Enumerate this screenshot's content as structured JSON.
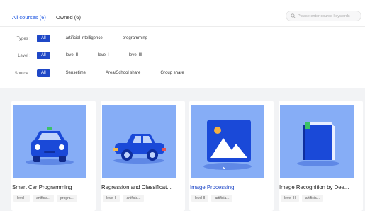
{
  "tabs": [
    {
      "label": "All courses (6)",
      "active": true
    },
    {
      "label": "Owned (6)",
      "active": false
    }
  ],
  "search": {
    "placeholder": "Please enter course keywords"
  },
  "filters": {
    "types": {
      "label": "Types :",
      "options": [
        "All",
        "artificial intelligence",
        "programming"
      ],
      "selected": "All"
    },
    "level": {
      "label": "Level :",
      "options": [
        "All",
        "level II",
        "level I",
        "level III"
      ],
      "selected": "All"
    },
    "source": {
      "label": "Source :",
      "options": [
        "All",
        "Sensetime",
        "Area/School share",
        "Group share"
      ],
      "selected": "All"
    }
  },
  "colors": {
    "accent": "#1f48c7",
    "thumb_bg": "#86adf6",
    "band_bg": "#f2f3f5"
  },
  "courses": [
    {
      "title": "Smart Car Programming",
      "icon": "car-front-icon",
      "tags": [
        "level I",
        "artificia...",
        "progra..."
      ]
    },
    {
      "title": "Regression and Classificat...",
      "icon": "car-side-icon",
      "tags": [
        "level II",
        "artificia..."
      ]
    },
    {
      "title": "Image Processing",
      "icon": "image-icon",
      "tags": [
        "level II",
        "artificia..."
      ],
      "highlighted": true
    },
    {
      "title": "Image Recognition by Dee...",
      "icon": "book-icon",
      "tags": [
        "level III",
        "artificia..."
      ]
    }
  ]
}
